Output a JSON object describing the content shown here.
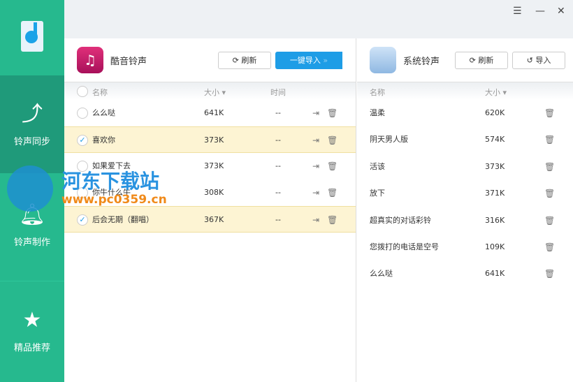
{
  "sidebar": {
    "items": [
      {
        "label": "铃声同步"
      },
      {
        "label": "铃声制作"
      },
      {
        "label": "精品推荐"
      }
    ]
  },
  "window": {
    "menu": "☰",
    "minimize": "—",
    "close": "✕"
  },
  "left": {
    "title": "酷音铃声",
    "refresh": "刷新",
    "import_all": "一键导入",
    "columns": {
      "name": "名称",
      "size": "大小",
      "time": "时间"
    },
    "rows": [
      {
        "name": "么么哒",
        "size": "641K",
        "time": "--",
        "checked": false
      },
      {
        "name": "喜欢你",
        "size": "373K",
        "time": "--",
        "checked": true
      },
      {
        "name": "如果爱下去",
        "size": "373K",
        "time": "--",
        "checked": false
      },
      {
        "name": "你牛什么牛",
        "size": "308K",
        "time": "--",
        "checked": false
      },
      {
        "name": "后会无期（翻唱）",
        "size": "367K",
        "time": "--",
        "checked": true
      }
    ]
  },
  "right": {
    "title": "系统铃声",
    "refresh": "刷新",
    "import": "导入",
    "columns": {
      "name": "名称",
      "size": "大小"
    },
    "rows": [
      {
        "name": "温柔",
        "size": "620K"
      },
      {
        "name": "阴天男人版",
        "size": "574K"
      },
      {
        "name": "活该",
        "size": "373K"
      },
      {
        "name": "放下",
        "size": "371K"
      },
      {
        "name": "超真实的对话彩铃",
        "size": "316K"
      },
      {
        "name": "您拨打的电话是空号",
        "size": "109K"
      },
      {
        "name": "么么哒",
        "size": "641K"
      }
    ]
  },
  "watermark": {
    "site": "河东下载站",
    "url": "www.pc0359.cn"
  }
}
